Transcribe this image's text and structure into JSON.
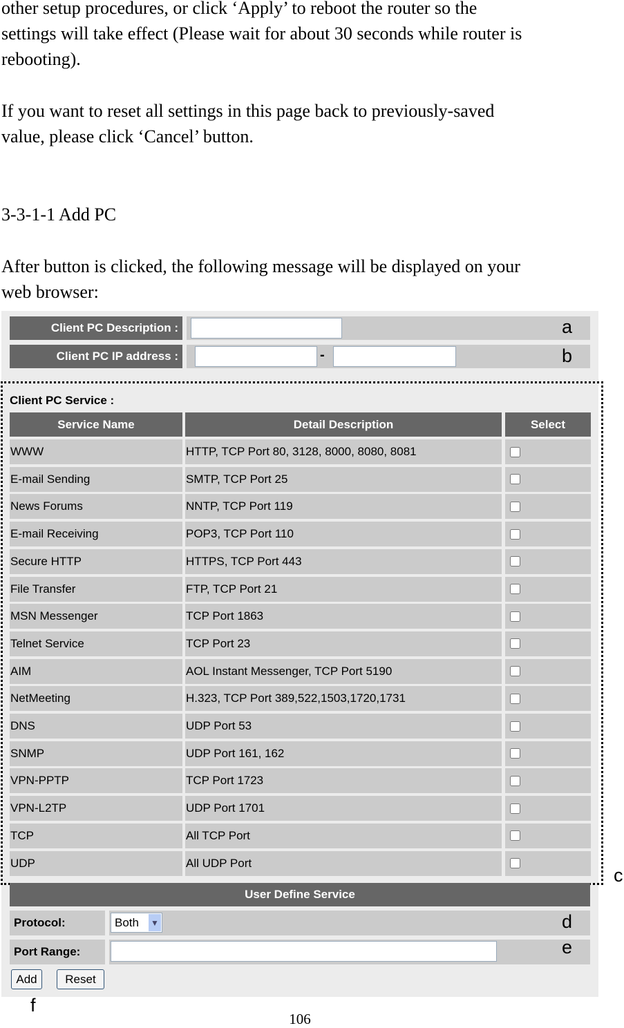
{
  "intro_lines": [
    "other setup procedures, or click ‘Apply’ to reboot the router so the",
    "settings will take effect (Please wait for about 30 seconds while router is",
    "rebooting)."
  ],
  "reset_lines": [
    "If you want to reset all settings in this page back to previously-saved",
    "value, please click ‘Cancel’ button."
  ],
  "section_heading": "3-3-1-1 Add PC",
  "after_lines": [
    "After button is clicked, the following message will be displayed on your",
    "web browser:"
  ],
  "form": {
    "description_label": "Client PC Description :",
    "description_value": "",
    "ip_label": "Client PC IP address :",
    "ip_start": "",
    "ip_end": "",
    "ip_separator": "-",
    "service_title": "Client PC Service :",
    "columns": [
      "Service Name",
      "Detail Description",
      "Select"
    ],
    "services": [
      {
        "name": "WWW",
        "detail": "HTTP, TCP Port 80, 3128, 8000, 8080, 8081",
        "checked": false
      },
      {
        "name": "E-mail Sending",
        "detail": "SMTP, TCP Port 25",
        "checked": false
      },
      {
        "name": "News Forums",
        "detail": "NNTP, TCP Port 119",
        "checked": false
      },
      {
        "name": "E-mail Receiving",
        "detail": "POP3, TCP Port 110",
        "checked": false
      },
      {
        "name": "Secure HTTP",
        "detail": "HTTPS, TCP Port 443",
        "checked": false
      },
      {
        "name": "File Transfer",
        "detail": "FTP, TCP Port 21",
        "checked": false
      },
      {
        "name": "MSN Messenger",
        "detail": "TCP Port 1863",
        "checked": false
      },
      {
        "name": "Telnet Service",
        "detail": "TCP Port 23",
        "checked": false
      },
      {
        "name": "AIM",
        "detail": "AOL Instant Messenger, TCP Port 5190",
        "checked": false
      },
      {
        "name": "NetMeeting",
        "detail": "H.323, TCP Port 389,522,1503,1720,1731",
        "checked": false
      },
      {
        "name": "DNS",
        "detail": "UDP Port 53",
        "checked": false
      },
      {
        "name": "SNMP",
        "detail": "UDP Port 161, 162",
        "checked": false
      },
      {
        "name": "VPN-PPTP",
        "detail": "TCP Port 1723",
        "checked": false
      },
      {
        "name": "VPN-L2TP",
        "detail": "UDP Port 1701",
        "checked": false
      },
      {
        "name": "TCP",
        "detail": "All TCP Port",
        "checked": false
      },
      {
        "name": "UDP",
        "detail": "All UDP Port",
        "checked": false
      }
    ],
    "user_define_title": "User Define Service",
    "protocol_label": "Protocol:",
    "protocol_value": "Both",
    "port_range_label": "Port Range:",
    "port_range_value": "",
    "add_label": "Add",
    "reset_label": "Reset"
  },
  "annotations": {
    "a": "a",
    "b": "b",
    "c": "c",
    "d": "d",
    "e": "e",
    "f": "f"
  },
  "page_number": "106"
}
